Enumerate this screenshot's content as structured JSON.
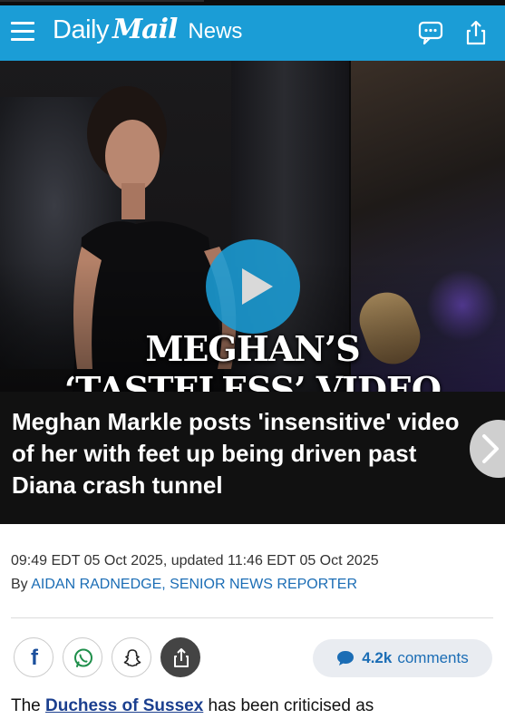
{
  "header": {
    "brand_daily": "Daily",
    "brand_mail": "Mail",
    "section": "News",
    "menu_icon": "hamburger-menu-icon",
    "comments_icon": "chat-bubble-icon",
    "share_icon": "share-icon",
    "accent_color": "#1b9dd6"
  },
  "hero": {
    "overlay_line1": "MEGHAN’S",
    "overlay_line2": "‘TASTELESS’ VIDEO",
    "play_icon": "play-icon"
  },
  "headline": {
    "text": "Meghan Markle posts 'insensitive' video of her with feet up being driven past Diana crash tunnel",
    "next_icon": "chevron-right-icon"
  },
  "meta": {
    "dateline": "09:49 EDT 05 Oct 2025, updated 11:46 EDT 05 Oct 2025",
    "by_prefix": "By",
    "author": "AIDAN RADNEDGE, SENIOR NEWS REPORTER",
    "author_color": "#1b6db5"
  },
  "social": {
    "facebook_label": "f",
    "facebook_icon": "facebook-icon",
    "whatsapp_icon": "whatsapp-icon",
    "snapchat_icon": "snapchat-icon",
    "share_icon": "share-icon"
  },
  "comments": {
    "count": "4.2k",
    "label": "comments",
    "icon": "comment-bubble-icon"
  },
  "body": {
    "text_before": "The ",
    "link_text": "Duchess of Sussex",
    "text_after": " has been criticised as"
  }
}
